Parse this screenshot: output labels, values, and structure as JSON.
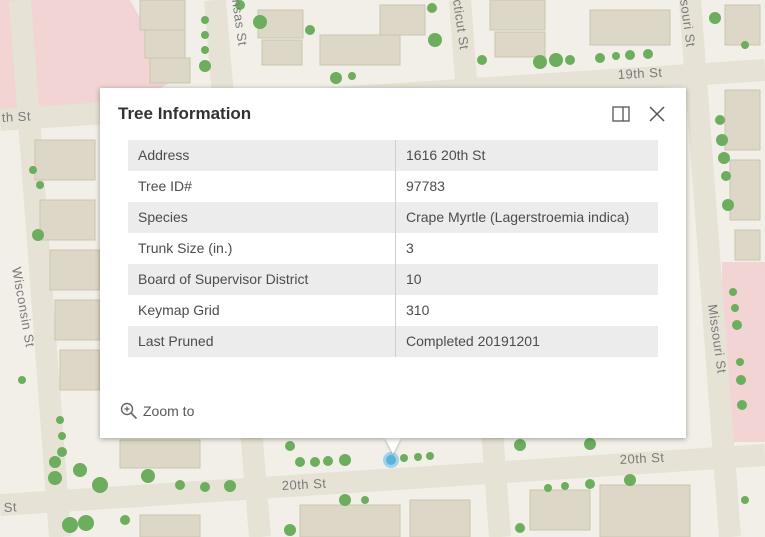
{
  "map": {
    "streets": {
      "nineteenth": "19th St",
      "twentieth_top": "20th St",
      "twentieth_bottom": "20th St",
      "left_top": "th St",
      "left_bottom": "St",
      "wisconsin": "Wisconsin St",
      "missouri_lower": "Missouri St",
      "missouri_upper": "souri St",
      "arkansas": "nsas St",
      "connecticut": "cticut St"
    },
    "colors": {
      "background": "#f1efe7",
      "building": "#dcd7c6",
      "tree": "#6cae5d",
      "highlight": "#00a8e8",
      "pink_zone": "#f2d4d4"
    }
  },
  "popup": {
    "title": "Tree Information",
    "dock_icon": "dock-panel-icon",
    "close_icon": "close-icon",
    "rows": [
      {
        "key": "Address",
        "value": "1616 20th St"
      },
      {
        "key": "Tree ID#",
        "value": "97783"
      },
      {
        "key": "Species",
        "value": "Crape Myrtle (Lagerstroemia indica)"
      },
      {
        "key": "Trunk Size (in.)",
        "value": "3"
      },
      {
        "key": "Board of Supervisor District",
        "value": "10"
      },
      {
        "key": "Keymap Grid",
        "value": "310"
      },
      {
        "key": "Last Pruned",
        "value": "Completed 20191201"
      }
    ],
    "zoom_label": "Zoom to",
    "zoom_icon": "zoom-in-icon"
  }
}
